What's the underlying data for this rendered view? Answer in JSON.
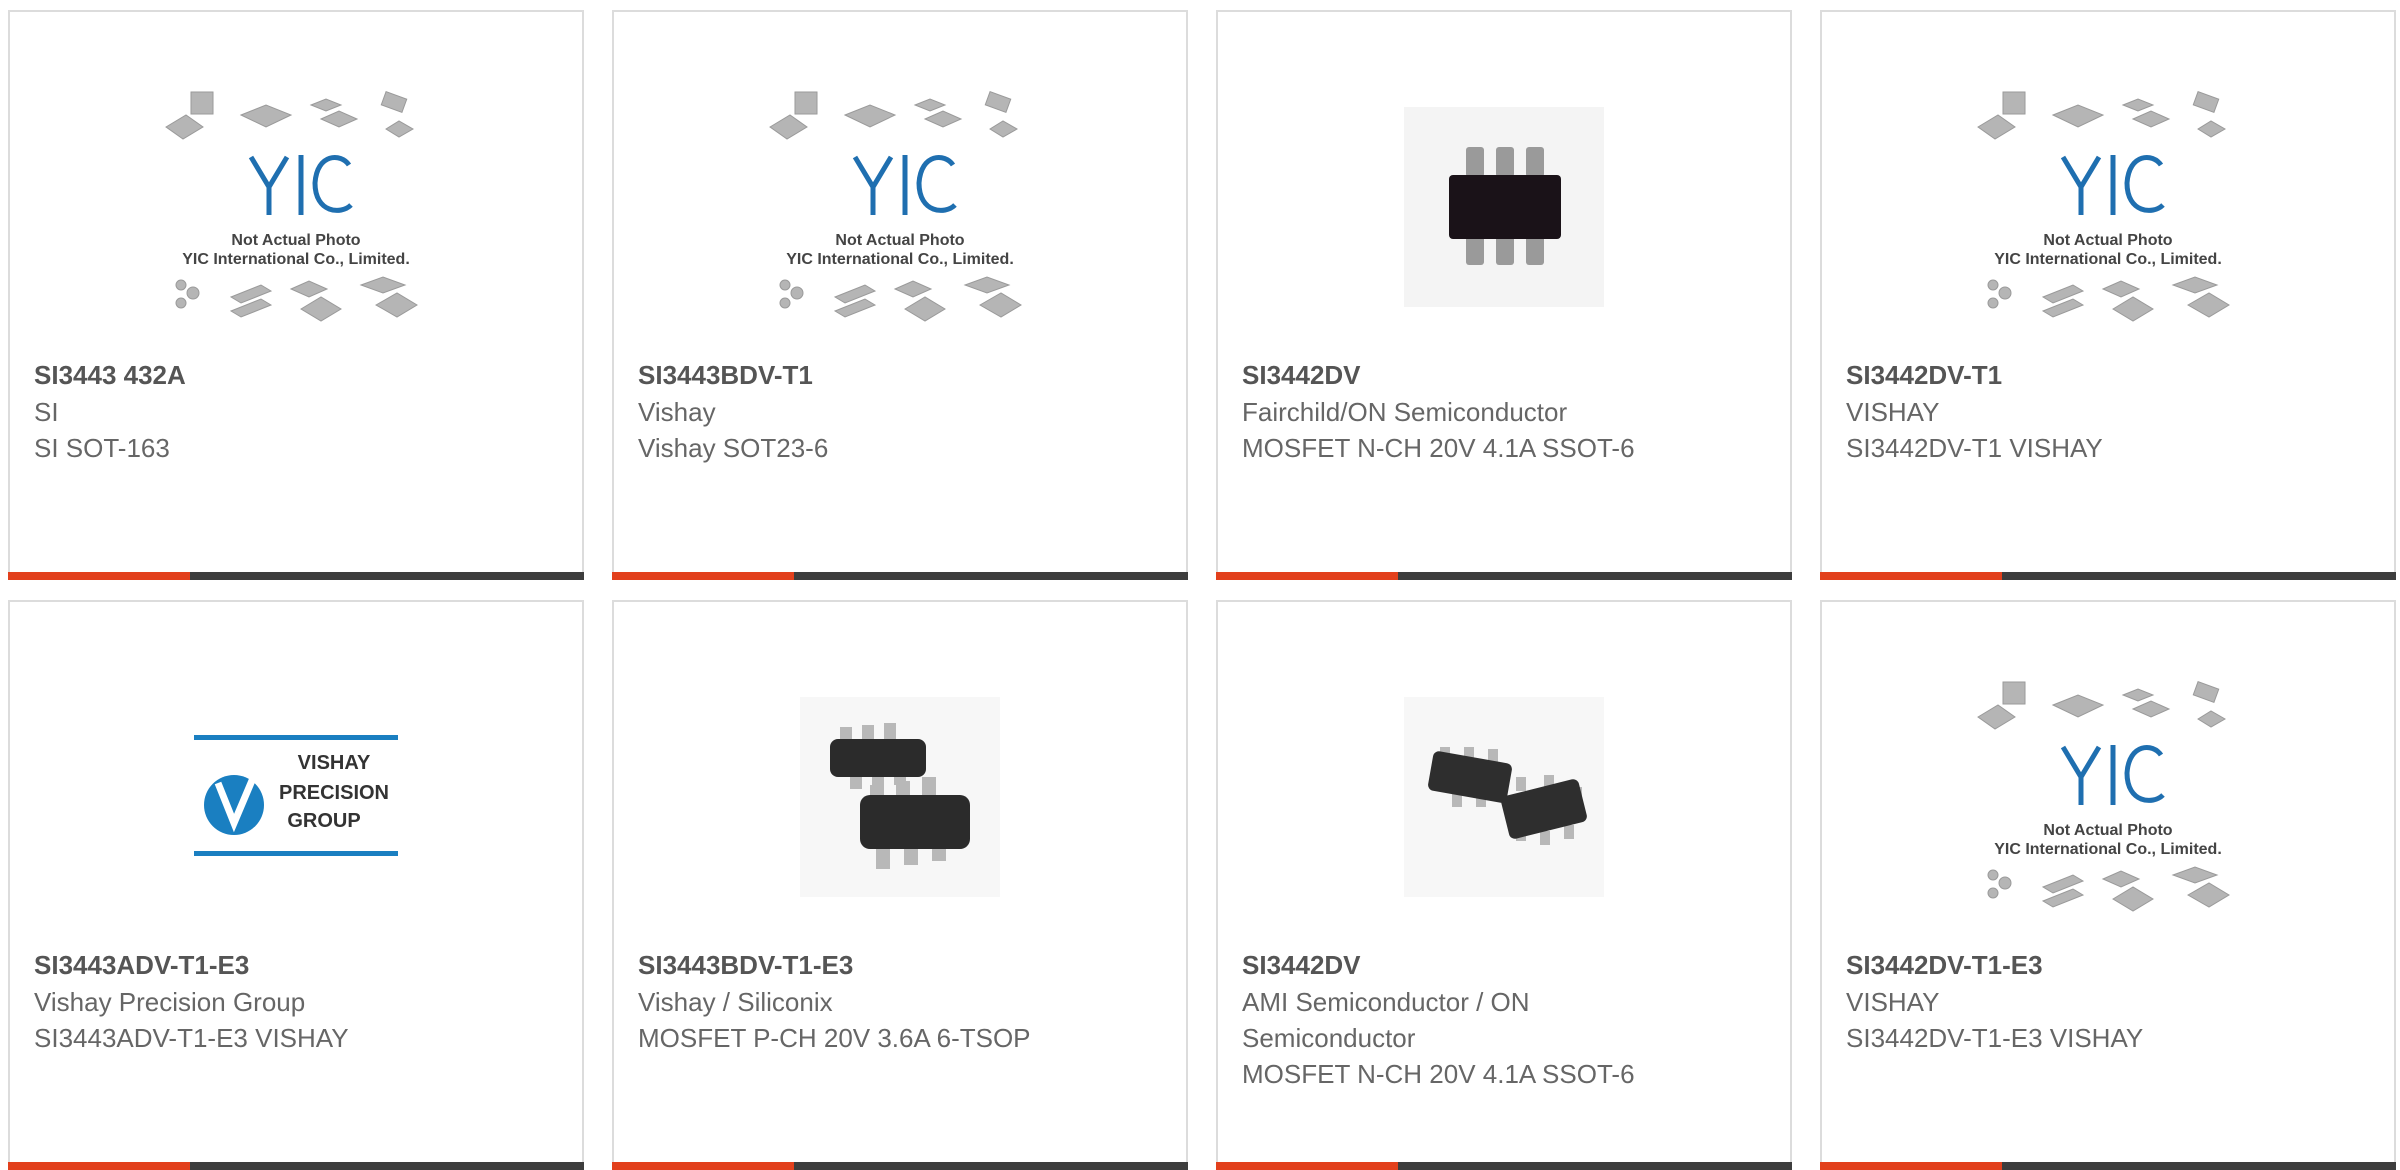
{
  "colors": {
    "accent": "#e2401c",
    "bar": "#3d3d3d",
    "text": "#666666",
    "title": "#555555"
  },
  "placeholder": {
    "line1": "Not Actual Photo",
    "line2": "YIC International Co., Limited.",
    "logo_text": "YIC"
  },
  "vishay_logo": {
    "line1": "VISHAY",
    "line2": "PRECISION",
    "line3": "GROUP"
  },
  "products": [
    {
      "part": "SI3443 432A",
      "manufacturer": "SI",
      "description": "SI SOT-163",
      "image": "placeholder"
    },
    {
      "part": "SI3443BDV-T1",
      "manufacturer": "Vishay",
      "description": "Vishay SOT23-6",
      "image": "placeholder"
    },
    {
      "part": "SI3442DV",
      "manufacturer": "Fairchild/ON Semiconductor",
      "description": "MOSFET N-CH 20V 4.1A SSOT-6",
      "image": "sot6-chip"
    },
    {
      "part": "SI3442DV-T1",
      "manufacturer": "VISHAY",
      "description": "SI3442DV-T1 VISHAY",
      "image": "placeholder"
    },
    {
      "part": "SI3443ADV-T1-E3",
      "manufacturer": "Vishay Precision Group",
      "description": "SI3443ADV-T1-E3 VISHAY",
      "image": "vishay-logo"
    },
    {
      "part": "SI3443BDV-T1-E3",
      "manufacturer": "Vishay / Siliconix",
      "description": "MOSFET P-CH 20V 3.6A 6-TSOP",
      "image": "tsop-pair"
    },
    {
      "part": "SI3442DV",
      "manufacturer": "AMI Semiconductor / ON Semiconductor",
      "description": "MOSFET N-CH 20V 4.1A SSOT-6",
      "image": "sot-pair"
    },
    {
      "part": "SI3442DV-T1-E3",
      "manufacturer": "VISHAY",
      "description": "SI3442DV-T1-E3 VISHAY",
      "image": "placeholder"
    }
  ]
}
